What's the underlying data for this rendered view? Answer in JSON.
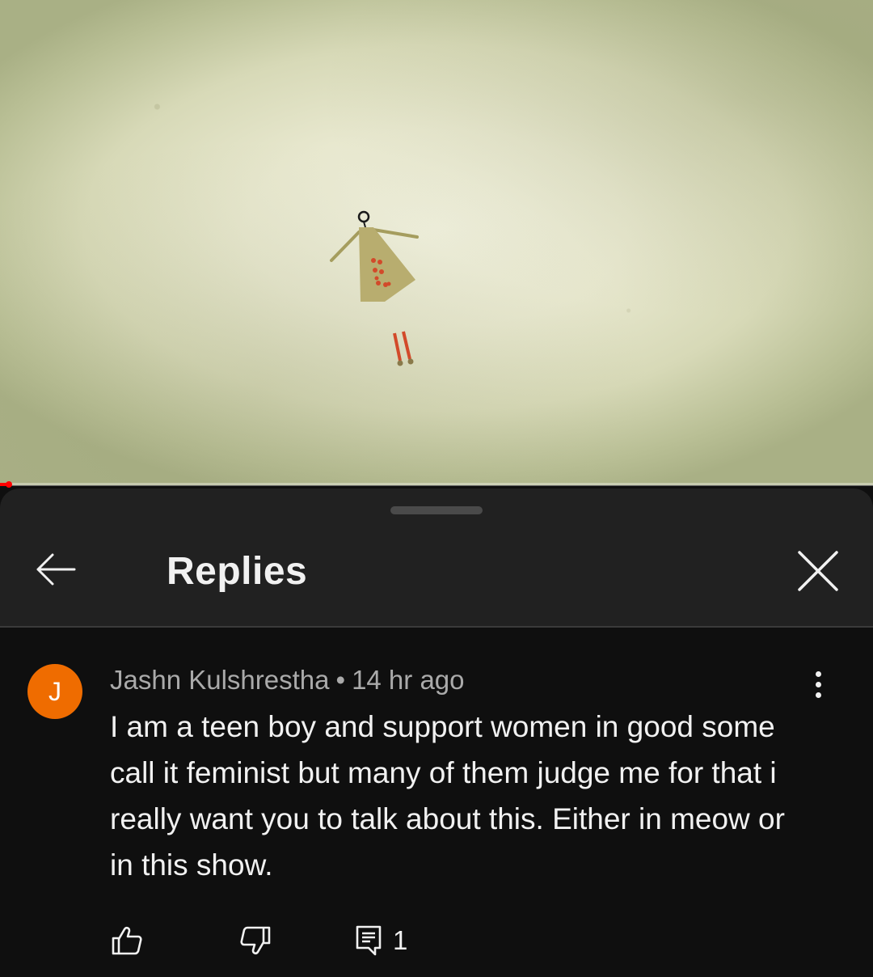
{
  "video": {
    "progress_fraction": 0.01
  },
  "sheet": {
    "title": "Replies"
  },
  "comment": {
    "avatar_letter": "J",
    "avatar_color": "#ef6c00",
    "author": "Jashn Kulshrestha",
    "separator": "•",
    "timestamp": "14 hr ago",
    "text": "I am a teen boy and support women in good some call it feminist but many of them judge me for that i really want you to talk about this. Either in meow or in this show.",
    "reply_count": "1"
  },
  "icons": {
    "back": "arrow-left-icon",
    "close": "close-icon",
    "more": "more-vertical-icon",
    "like": "thumbs-up-icon",
    "dislike": "thumbs-down-icon",
    "reply": "reply-comment-icon"
  },
  "colors": {
    "progress": "#ff0000",
    "header_bg": "#212121",
    "sheet_bg": "#0f0f0f"
  }
}
